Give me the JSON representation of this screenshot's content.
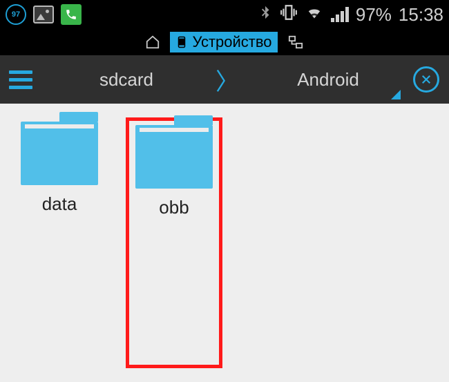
{
  "status": {
    "ring_number": "97",
    "battery_text": "97%",
    "time": "15:38"
  },
  "tabs": {
    "device_label": "Устройство"
  },
  "breadcrumb": {
    "parent": "sdcard",
    "current": "Android"
  },
  "folders": [
    {
      "name": "data",
      "highlighted": false
    },
    {
      "name": "obb",
      "highlighted": true
    }
  ]
}
